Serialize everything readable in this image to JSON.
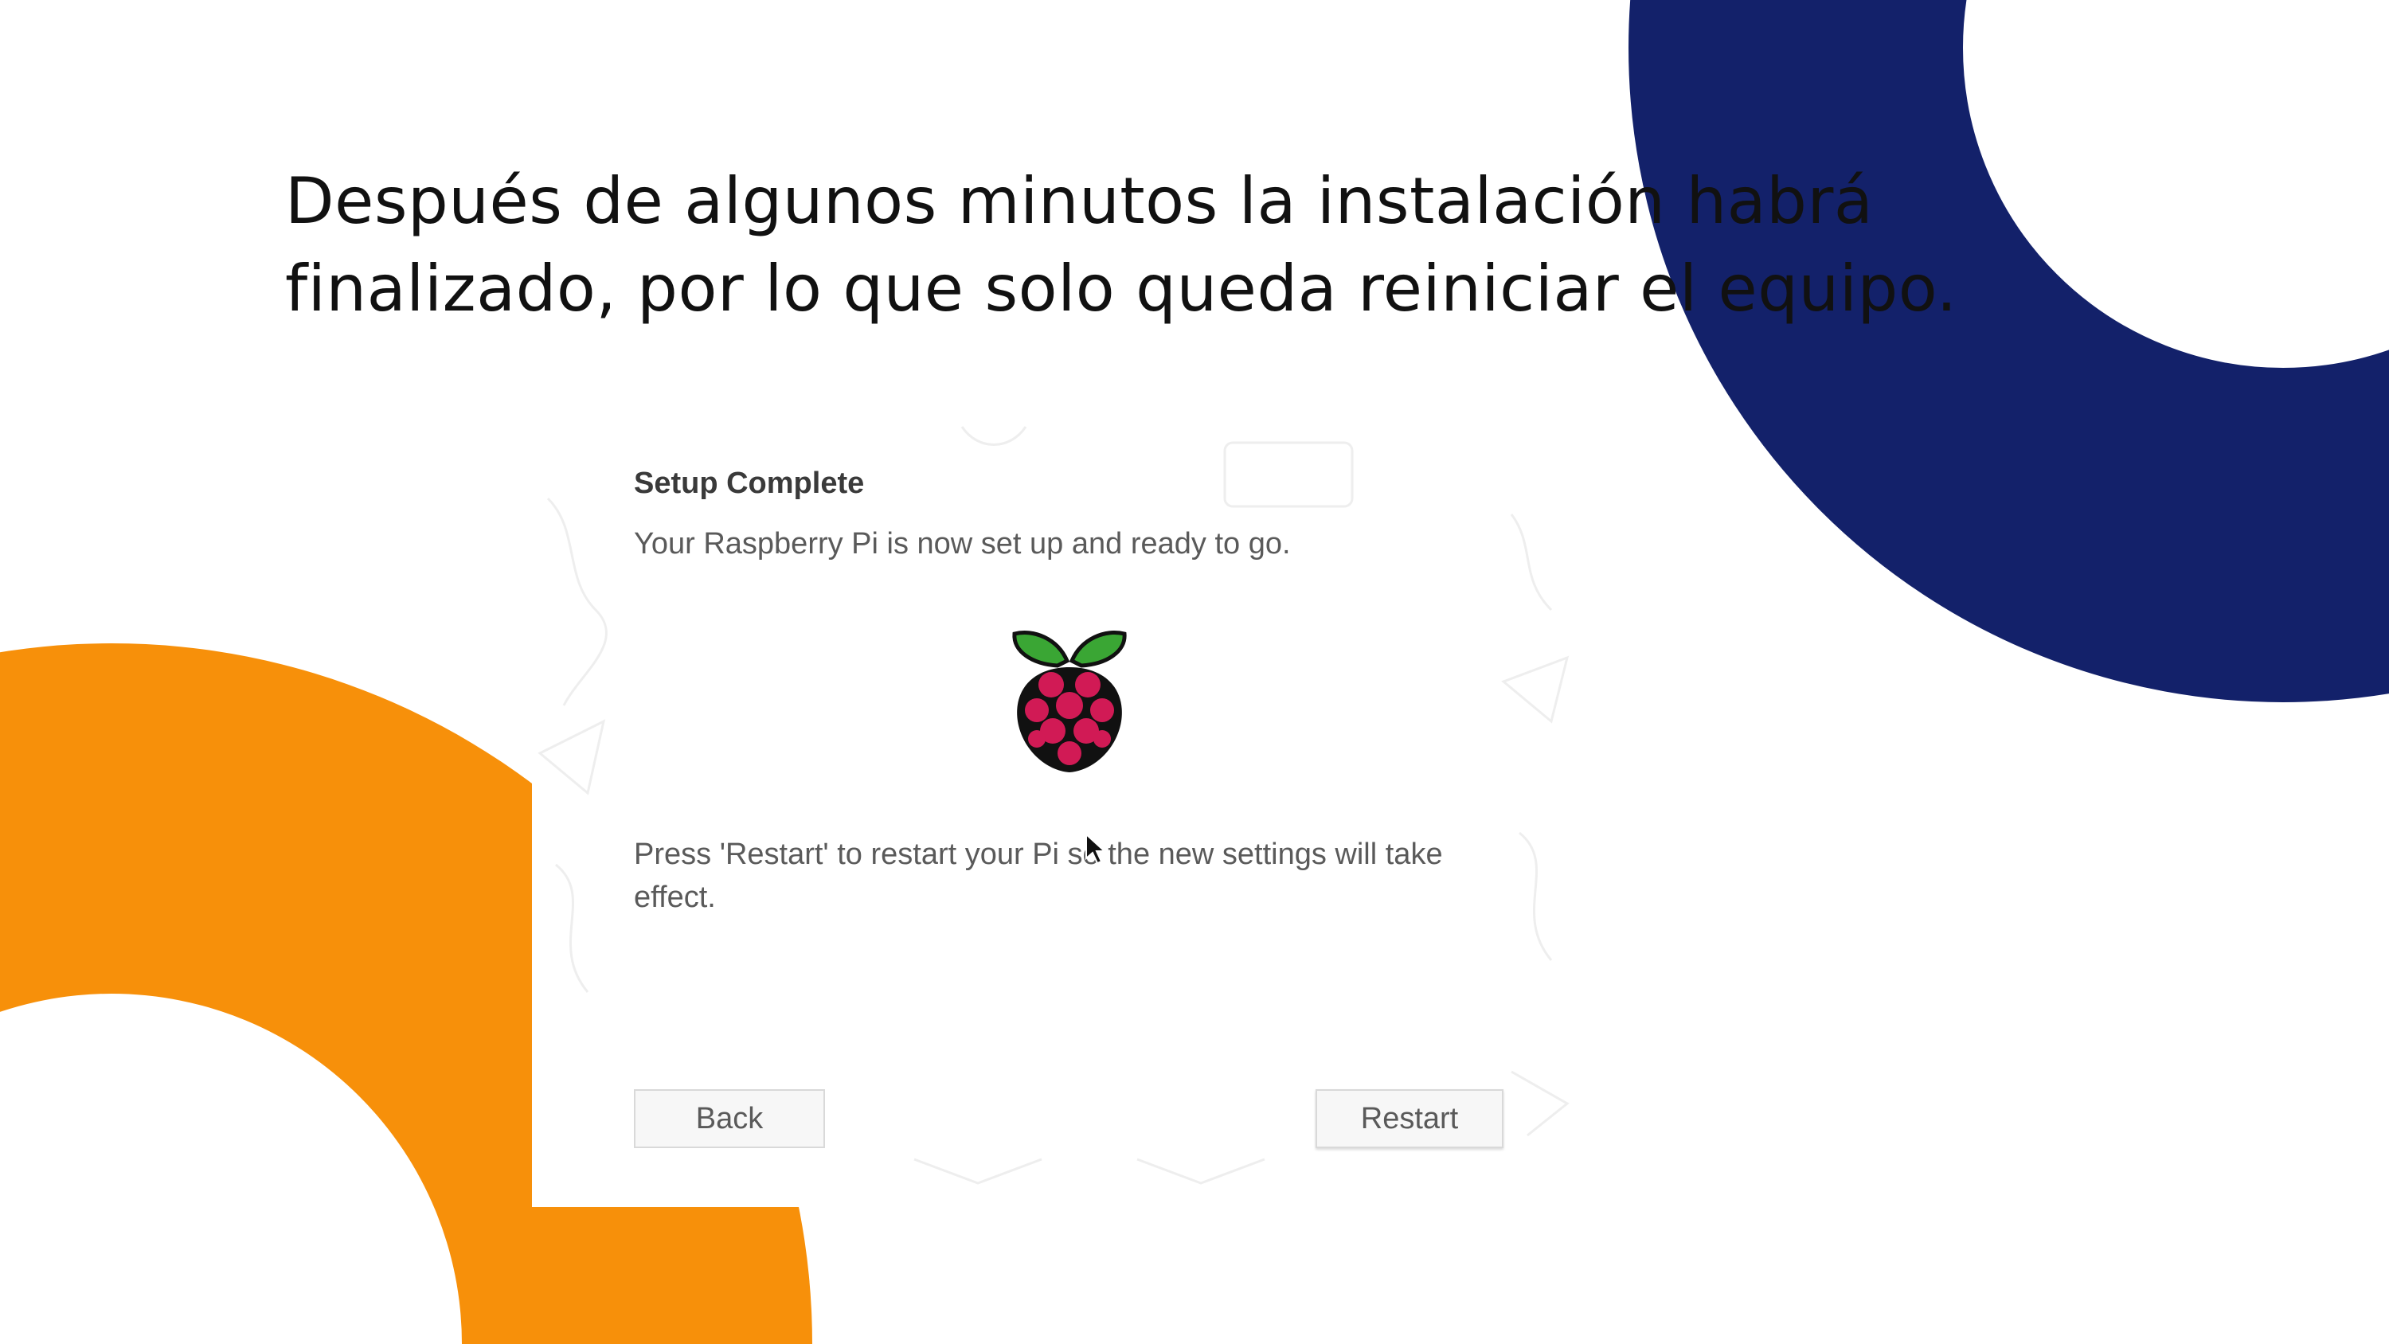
{
  "slide": {
    "title_line1": "Después de algunos minutos la instalación habrá",
    "title_line2": "finalizado, por lo que solo queda reiniciar el equipo."
  },
  "dialog": {
    "title": "Setup Complete",
    "message": "Your Raspberry Pi is now set up and ready to go.",
    "note": "Press 'Restart' to restart your Pi so the new settings will take effect.",
    "back_label": "Back",
    "restart_label": "Restart"
  },
  "icons": {
    "logo": "raspberry-pi-logo-icon",
    "cursor": "mouse-cursor-icon"
  },
  "colors": {
    "navy_accent": "#13216a",
    "orange_accent": "#f7900a",
    "leaf_green": "#3aa634",
    "berry_red": "#d11a55"
  }
}
